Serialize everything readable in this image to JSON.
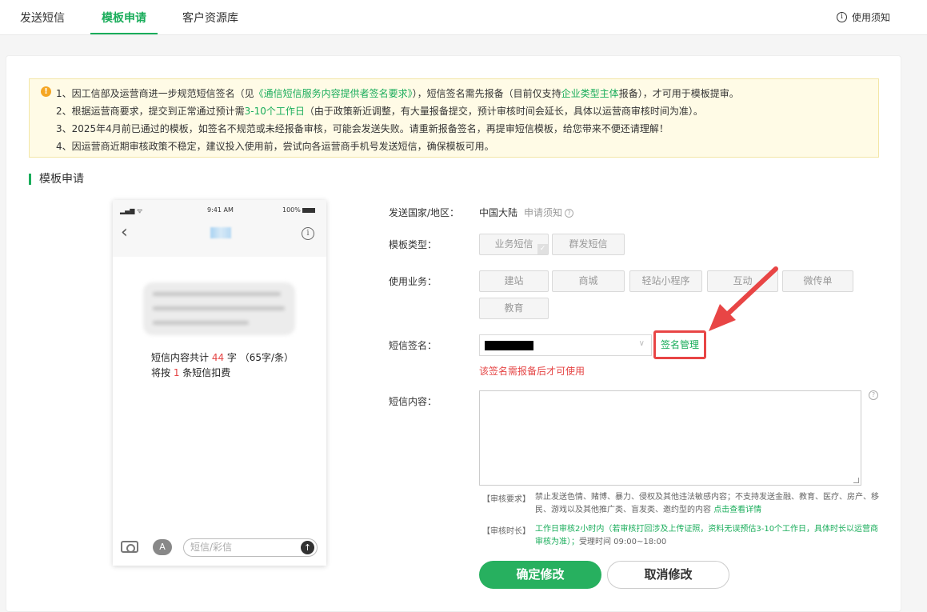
{
  "tabs": [
    {
      "label": "发送短信"
    },
    {
      "label": "模板申请"
    },
    {
      "label": "客户资源库"
    }
  ],
  "help_link": "使用须知",
  "notice": {
    "l1_a": "1、因工信部及运营商进一步规范短信签名（见",
    "l1_link": "《通信短信服务内容提供者签名要求》",
    "l1_b": "），短信签名需先报备（目前仅支持",
    "l1_link2": "企业类型主体",
    "l1_c": "报备），才可用于模板提审。",
    "l2_a": "2、根据运营商要求，提交到正常通过预计需",
    "l2_link": "3-10个工作日",
    "l2_b": "（由于政策新近调整，有大量报备提交，预计审核时间会延长，具体以运营商审核时间为准）。",
    "l3": "3、2025年4月前已通过的模板，如签名不规范或未经报备审核，可能会发送失败。请重新报备签名，再提审短信模板，给您带来不便还请理解！",
    "l4": "4、因运营商近期审核政策不稳定，建议投入使用前，尝试向各运营商手机号发送短信，确保模板可用。"
  },
  "section_title": "模板申请",
  "phone": {
    "signal": "▂▄▆ ᯤ",
    "time": "9:41 AM",
    "battery": "100%",
    "count_a": "短信内容共计 ",
    "count_num": "44",
    "count_b": " 字 （65字/条）将按 ",
    "count_sms": "1",
    "count_c": " 条短信扣费",
    "input_placeholder": "短信/彩信"
  },
  "form": {
    "country_label": "发送国家/地区：",
    "country_value": "中国大陆",
    "country_link": "申请须知",
    "type_label": "模板类型：",
    "types": [
      "业务短信",
      "群发短信"
    ],
    "biz_label": "使用业务：",
    "biz": [
      "建站",
      "商城",
      "轻站小程序",
      "互动",
      "微传单",
      "教育"
    ],
    "sign_label": "短信签名：",
    "sign_manage": "签名管理",
    "sign_warning": "该签名需报备后才可使用",
    "content_label": "短信内容：",
    "req_tag": "【审核要求】",
    "req_text": "禁止发送色情、赌博、暴力、侵权及其他违法敏感内容；不支持发送金融、教育、医疗、房产、移民、游戏以及其他推广类、盲发类、邀约型的内容",
    "req_link": "点击查看详情",
    "time_tag": "【审核时长】",
    "time_text": "工作日审核2小时内（若审核打回涉及上传证照，资料无误预估3-10个工作日，具体时长以运营商审核为准）；",
    "time_text2": "受理时间 09:00~18:00",
    "confirm": "确定修改",
    "cancel": "取消修改"
  },
  "colors": {
    "accent": "#1aad5b",
    "warning": "#e54545",
    "notice_bg": "#fffbe6"
  }
}
